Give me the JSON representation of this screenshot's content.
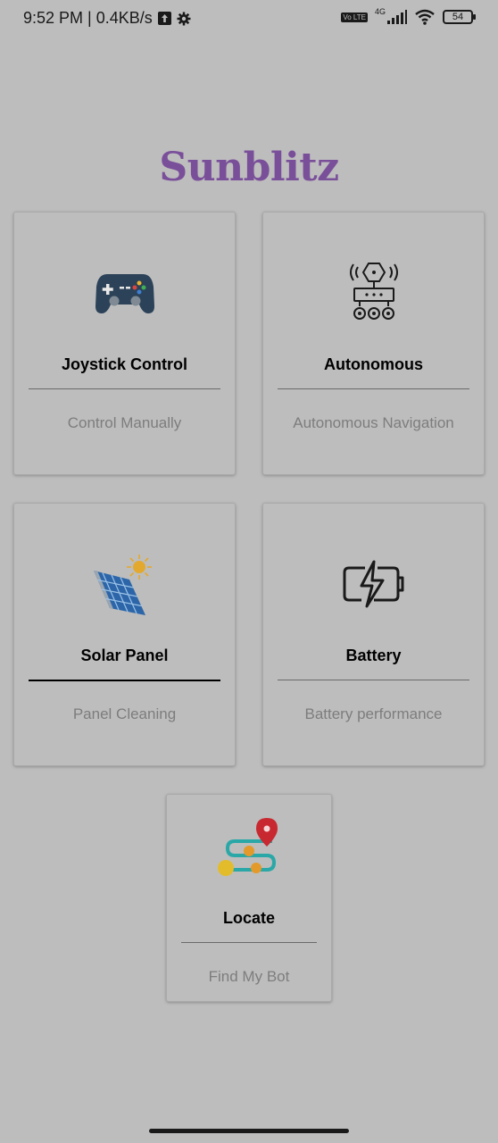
{
  "status_bar": {
    "time_speed": "9:52 PM | 0.4KB/s",
    "network": "4G",
    "volte": "Vo LTE",
    "battery": "54"
  },
  "app": {
    "title": "Sunblitz",
    "title_color": "#7a4f9a"
  },
  "cards": {
    "joystick": {
      "title": "Joystick Control",
      "subtitle": "Control Manually",
      "icon": "gamepad-icon"
    },
    "autonomous": {
      "title": "Autonomous",
      "subtitle": "Autonomous Navigation",
      "icon": "robot-rover-icon"
    },
    "solar": {
      "title": "Solar Panel",
      "subtitle": "Panel Cleaning",
      "icon": "solar-panel-icon"
    },
    "battery": {
      "title": "Battery",
      "subtitle": "Battery performance",
      "icon": "battery-charging-icon"
    },
    "locate": {
      "title": "Locate",
      "subtitle": "Find My Bot",
      "icon": "route-pin-icon"
    }
  }
}
